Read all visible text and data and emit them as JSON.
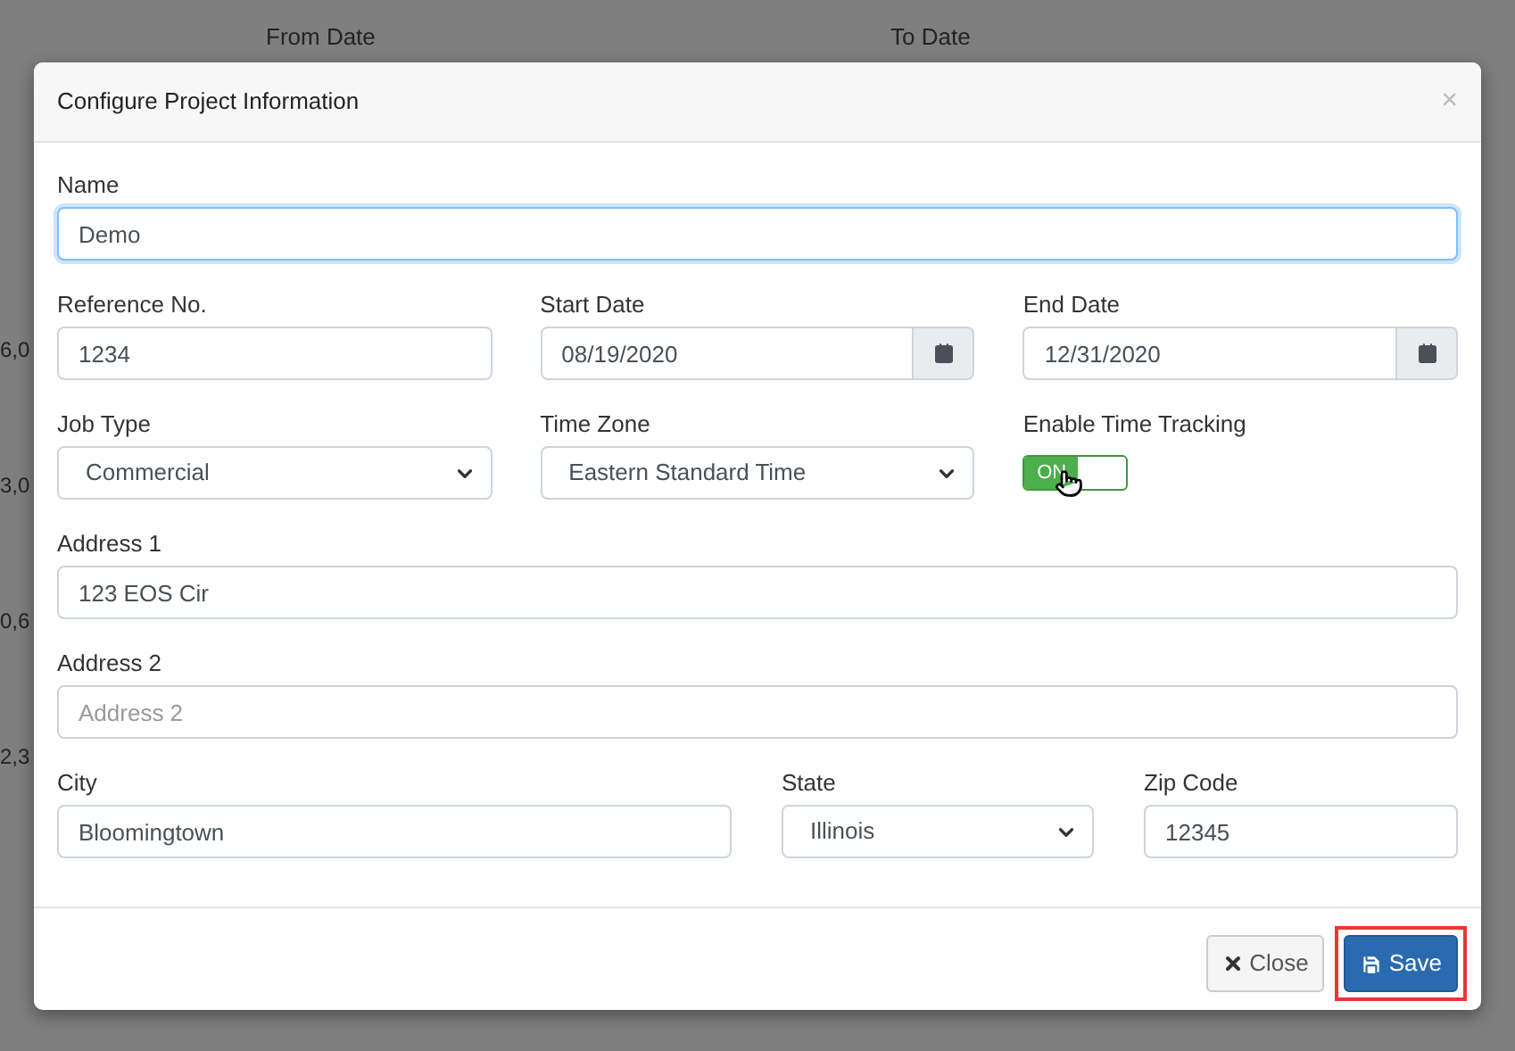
{
  "background": {
    "filters": [
      "From Date",
      "To Date"
    ],
    "row_fragments": [
      "6,0",
      "3,0",
      "0,6",
      "2,3"
    ]
  },
  "dialog": {
    "title": "Configure Project Information",
    "close_symbol": "×",
    "rows": [
      [
        {
          "kind": "text",
          "label": "Name",
          "value": "Demo",
          "focused": true
        }
      ],
      [
        {
          "kind": "text",
          "label": "Reference No.",
          "value": "1234",
          "focused": false
        },
        {
          "kind": "date",
          "label": "Start Date",
          "value": "08/19/2020",
          "focused": false
        },
        {
          "kind": "date",
          "label": "End Date",
          "value": "12/31/2020",
          "focused": false
        }
      ],
      [
        {
          "kind": "select",
          "label": "Job Type",
          "value": "Commercial",
          "focused": false
        },
        {
          "kind": "select",
          "label": "Time Zone",
          "value": "Eastern Standard Time",
          "focused": false
        },
        {
          "kind": "toggle",
          "label": "Enable Time Tracking",
          "value": "ON",
          "on": true
        }
      ],
      [
        {
          "kind": "text",
          "label": "Address 1",
          "value": "123 EOS Cir",
          "focused": false
        }
      ],
      [
        {
          "kind": "text",
          "label": "Address 2",
          "placeholder": "Address 2",
          "focused": false
        }
      ],
      [
        {
          "kind": "text",
          "label": "City",
          "value": "Bloomingtown",
          "focused": false
        },
        {
          "kind": "select",
          "label": "State",
          "value": "Illinois",
          "focused": false
        },
        {
          "kind": "text",
          "label": "Zip Code",
          "value": "12345",
          "focused": false
        }
      ]
    ],
    "buttons": [
      {
        "kind": "close",
        "label": "Close",
        "highlighted": false
      },
      {
        "kind": "save",
        "label": "Save",
        "highlighted": true
      }
    ]
  }
}
